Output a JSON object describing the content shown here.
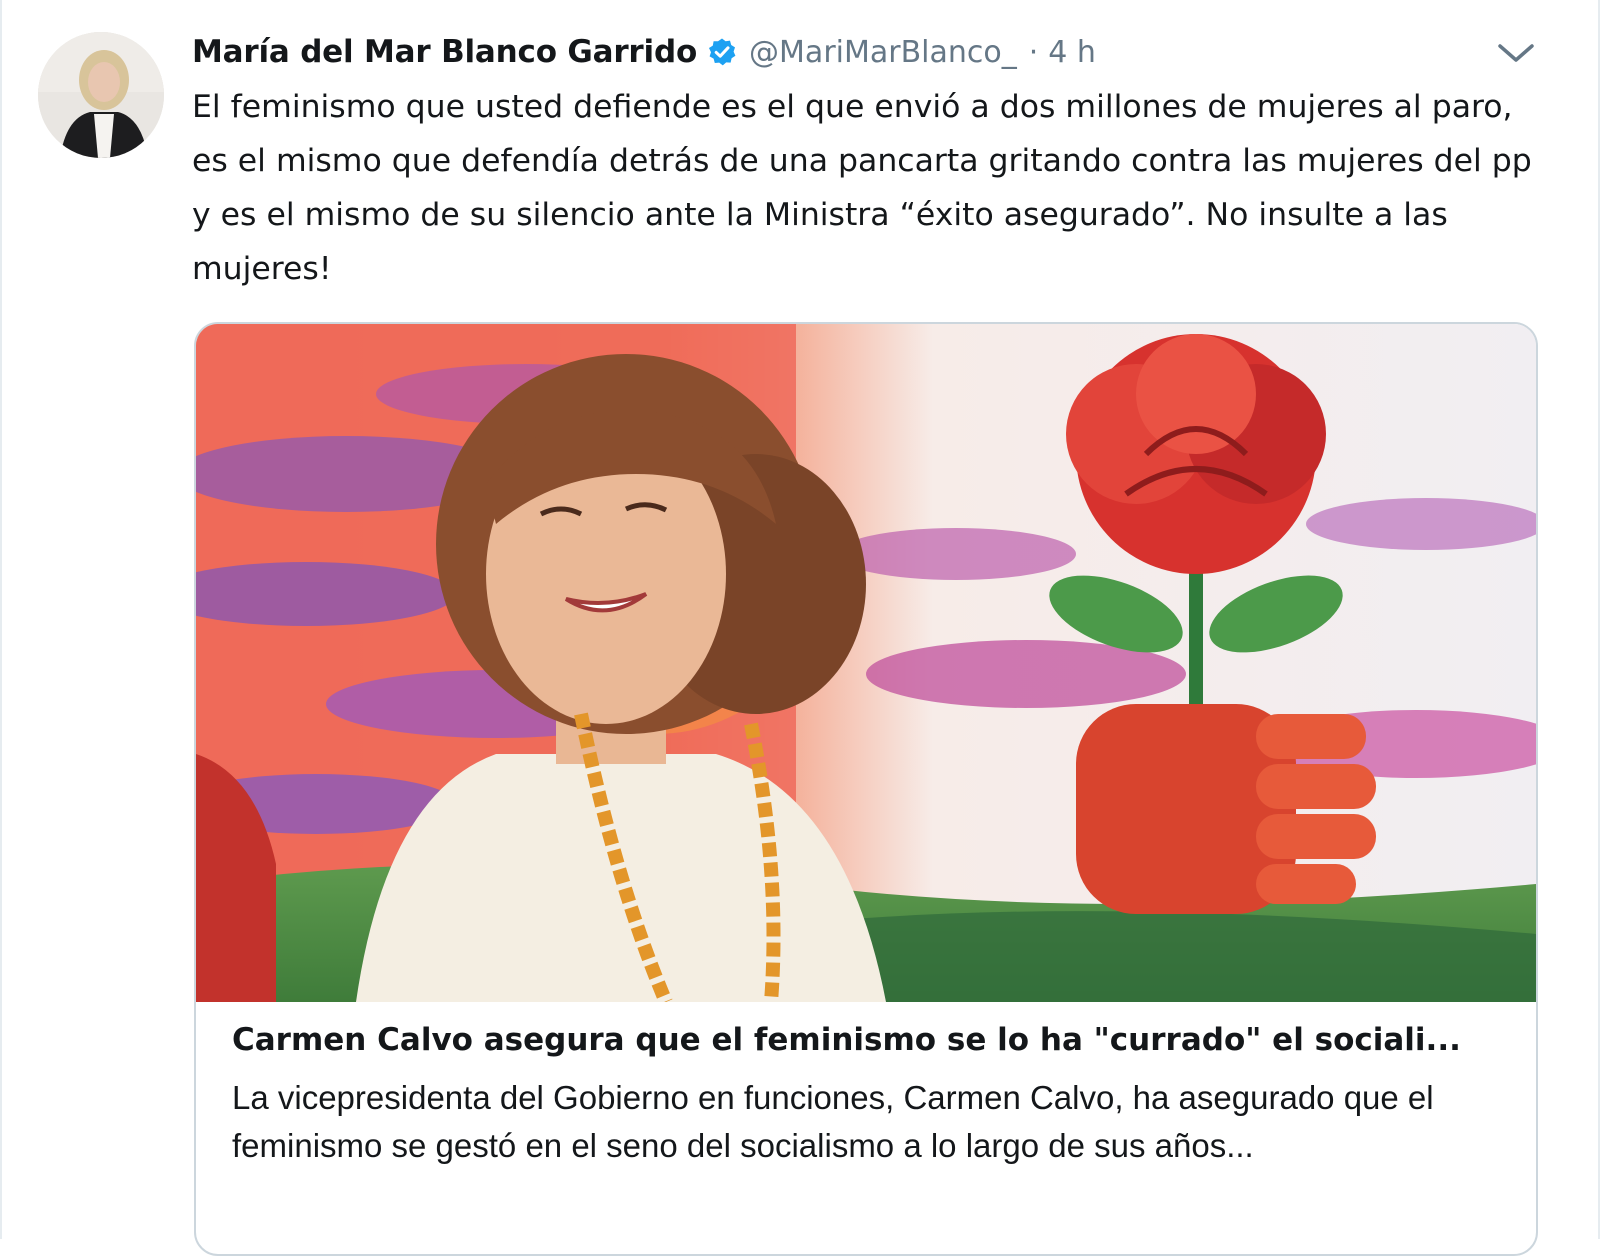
{
  "tweet": {
    "author_name": "María del Mar Blanco Garrido",
    "verified_icon": "verified-badge-icon",
    "handle": "@MariMarBlanco_",
    "separator": "·",
    "time": "4 h",
    "menu_icon": "chevron-down-icon",
    "text": "El feminismo que usted defiende es el que envió a dos millones de mujeres al paro, es el mismo que defendía detrás de una pancarta gritando contra las mujeres del pp y es el mismo de su silencio ante la Ministra “éxito asegurado”. No insulte a las mujeres!"
  },
  "card": {
    "title": "Carmen Calvo asegura que el feminismo se lo ha \"currado\" el sociali...",
    "description": "La vicepresidenta del Gobierno en funciones, Carmen Calvo, ha asegurado que el feminismo se gestó en el seno del socialismo a lo largo de sus años..."
  },
  "colors": {
    "text": "#14171a",
    "secondary": "#657786",
    "verified": "#1da1f2",
    "border": "#ccd6dd"
  }
}
